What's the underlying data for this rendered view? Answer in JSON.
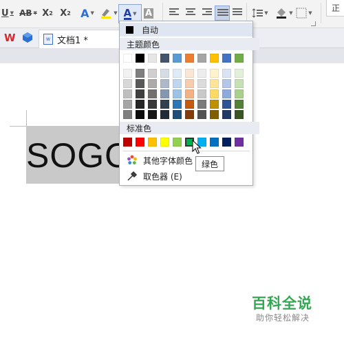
{
  "ribbon": {
    "underline": "U",
    "strikethrough": "AB",
    "superscript_base": "X",
    "superscript_mark": "2",
    "subscript_base": "X",
    "subscript_mark": "2",
    "text_effect": "A",
    "font_color": "A",
    "char_shading": "A",
    "right_cut_text": "正"
  },
  "tabbar": {
    "doc_title": "文档1 *"
  },
  "document": {
    "text": "SOGO"
  },
  "font_color_menu": {
    "auto_label": "自动",
    "theme_heading": "主题颜色",
    "standard_heading": "标准色",
    "more_colors_label": "其他字体颜色",
    "eyedropper_label": "取色器 (E)",
    "theme_top_row": [
      "#ffffff",
      "#000000",
      "#e7e6e6",
      "#44546a",
      "#5b9bd5",
      "#ed7d31",
      "#a5a5a5",
      "#ffc000",
      "#4472c4",
      "#70ad47"
    ],
    "theme_shades": [
      [
        "#f2f2f2",
        "#7f7f7f",
        "#d0cece",
        "#d6dce4",
        "#deebf6",
        "#fbe5d5",
        "#ededed",
        "#fff2cc",
        "#dae3f3",
        "#e2efd9"
      ],
      [
        "#d8d8d8",
        "#595959",
        "#aeaaaa",
        "#adb9ca",
        "#bdd7ee",
        "#f7cbac",
        "#dbdbdb",
        "#fee599",
        "#b4c6e7",
        "#c5e0b3"
      ],
      [
        "#bfbfbf",
        "#3f3f3f",
        "#757070",
        "#8496b0",
        "#9cc3e5",
        "#f4b183",
        "#c9c9c9",
        "#ffd965",
        "#8eaadb",
        "#a8d08d"
      ],
      [
        "#a5a5a5",
        "#262626",
        "#3a3838",
        "#323f4f",
        "#2e75b5",
        "#c55a11",
        "#7b7b7b",
        "#bf9000",
        "#2f5496",
        "#538135"
      ],
      [
        "#7f7f7f",
        "#0c0c0c",
        "#171616",
        "#222a35",
        "#1e4e79",
        "#843c0b",
        "#525252",
        "#7f6000",
        "#1f3864",
        "#375623"
      ]
    ],
    "standard_colors": [
      "#c00000",
      "#ff0000",
      "#ffc000",
      "#ffff00",
      "#92d050",
      "#00b050",
      "#00b0f0",
      "#0070c0",
      "#002060",
      "#7030a0"
    ],
    "hover_tooltip": "绿色"
  },
  "watermark": {
    "title": "百科全说",
    "subtitle": "助你轻松解决"
  }
}
